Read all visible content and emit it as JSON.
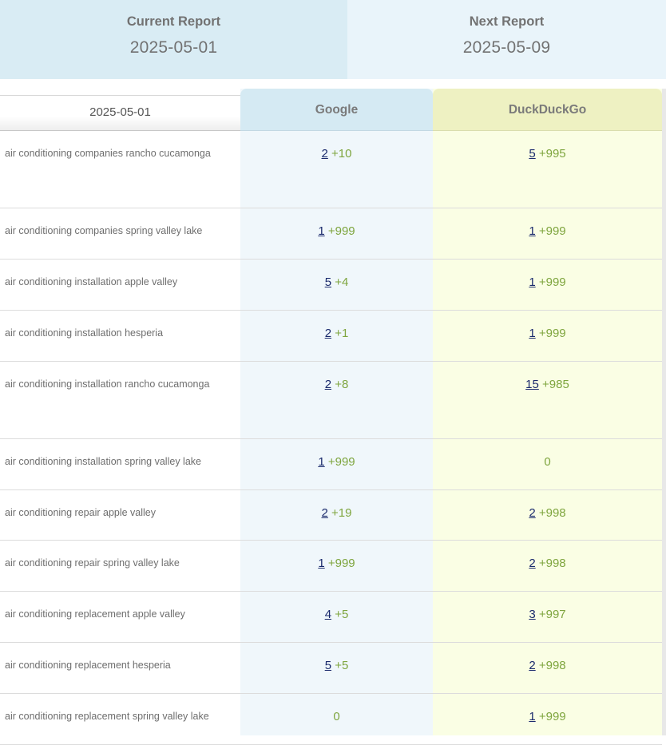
{
  "reports": {
    "current": {
      "label": "Current Report",
      "date": "2025-05-01"
    },
    "next": {
      "label": "Next Report",
      "date": "2025-05-09"
    }
  },
  "table": {
    "date_header": "2025-05-01",
    "columns": [
      "Google",
      "DuckDuckGo"
    ],
    "rows": [
      {
        "keyword": "air conditioning companies rancho cucamonga",
        "google": {
          "rank": "2",
          "delta": "+10"
        },
        "ddg": {
          "rank": "5",
          "delta": "+995"
        }
      },
      {
        "keyword": "air conditioning companies spring valley lake",
        "google": {
          "rank": "1",
          "delta": "+999"
        },
        "ddg": {
          "rank": "1",
          "delta": "+999"
        }
      },
      {
        "keyword": "air conditioning installation apple valley",
        "google": {
          "rank": "5",
          "delta": "+4"
        },
        "ddg": {
          "rank": "1",
          "delta": "+999"
        }
      },
      {
        "keyword": "air conditioning installation hesperia",
        "google": {
          "rank": "2",
          "delta": "+1"
        },
        "ddg": {
          "rank": "1",
          "delta": "+999"
        }
      },
      {
        "keyword": "air conditioning installation rancho cucamonga",
        "google": {
          "rank": "2",
          "delta": "+8"
        },
        "ddg": {
          "rank": "15",
          "delta": "+985"
        }
      },
      {
        "keyword": "air conditioning installation spring valley lake",
        "google": {
          "rank": "1",
          "delta": "+999"
        },
        "ddg": {
          "value": "0"
        }
      },
      {
        "keyword": "air conditioning repair apple valley",
        "google": {
          "rank": "2",
          "delta": "+19"
        },
        "ddg": {
          "rank": "2",
          "delta": "+998"
        }
      },
      {
        "keyword": "air conditioning repair spring valley lake",
        "google": {
          "rank": "1",
          "delta": "+999"
        },
        "ddg": {
          "rank": "2",
          "delta": "+998"
        }
      },
      {
        "keyword": "air conditioning replacement apple valley",
        "google": {
          "rank": "4",
          "delta": "+5"
        },
        "ddg": {
          "rank": "3",
          "delta": "+997"
        }
      },
      {
        "keyword": "air conditioning replacement hesperia",
        "google": {
          "rank": "5",
          "delta": "+5"
        },
        "ddg": {
          "rank": "2",
          "delta": "+998"
        }
      },
      {
        "keyword": "air conditioning replacement spring valley lake",
        "google": {
          "value": "0"
        },
        "ddg": {
          "rank": "1",
          "delta": "+999"
        }
      }
    ]
  }
}
